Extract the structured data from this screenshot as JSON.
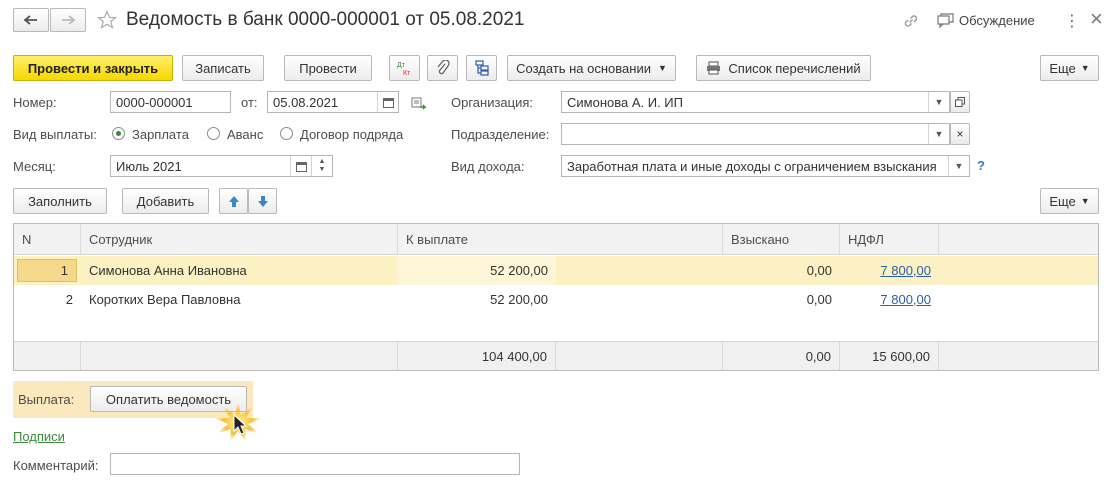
{
  "window": {
    "title": "Ведомость в банк 0000-000001 от 05.08.2021",
    "discussion": "Обсуждение",
    "kebab": "⋮",
    "close": "×"
  },
  "toolbar": {
    "post_close": "Провести и закрыть",
    "save": "Записать",
    "post": "Провести",
    "create_based": "Создать на основании",
    "transfer_list": "Список перечислений",
    "more": "Еще"
  },
  "form": {
    "number_label": "Номер:",
    "number_value": "0000-000001",
    "date_label": "от:",
    "date_value": "05.08.2021",
    "org_label": "Организация:",
    "org_value": "Симонова А. И. ИП",
    "pay_type_label": "Вид выплаты:",
    "pay_type_options": [
      "Зарплата",
      "Аванс",
      "Договор подряда"
    ],
    "division_label": "Подразделение:",
    "division_value": "",
    "month_label": "Месяц:",
    "month_value": "Июль 2021",
    "income_label": "Вид дохода:",
    "income_value": "Заработная плата и иные доходы с ограничением взыскания",
    "help": "?"
  },
  "table_toolbar": {
    "fill": "Заполнить",
    "add": "Добавить",
    "more": "Еще"
  },
  "table": {
    "headers": [
      "N",
      "Сотрудник",
      "К выплате",
      "Взыскано",
      "НДФЛ"
    ],
    "rows": [
      {
        "n": "1",
        "employee": "Симонова Анна Ивановна",
        "pay": "52 200,00",
        "collected": "0,00",
        "ndfl": "7 800,00"
      },
      {
        "n": "2",
        "employee": "Коротких Вера Павловна",
        "pay": "52 200,00",
        "collected": "0,00",
        "ndfl": "7 800,00"
      }
    ],
    "totals": {
      "pay": "104 400,00",
      "collected": "0,00",
      "ndfl": "15 600,00"
    }
  },
  "payment": {
    "label": "Выплата:",
    "button": "Оплатить ведомость"
  },
  "signatures_link": "Подписи",
  "comment_label": "Комментарий:",
  "comment_value": ""
}
